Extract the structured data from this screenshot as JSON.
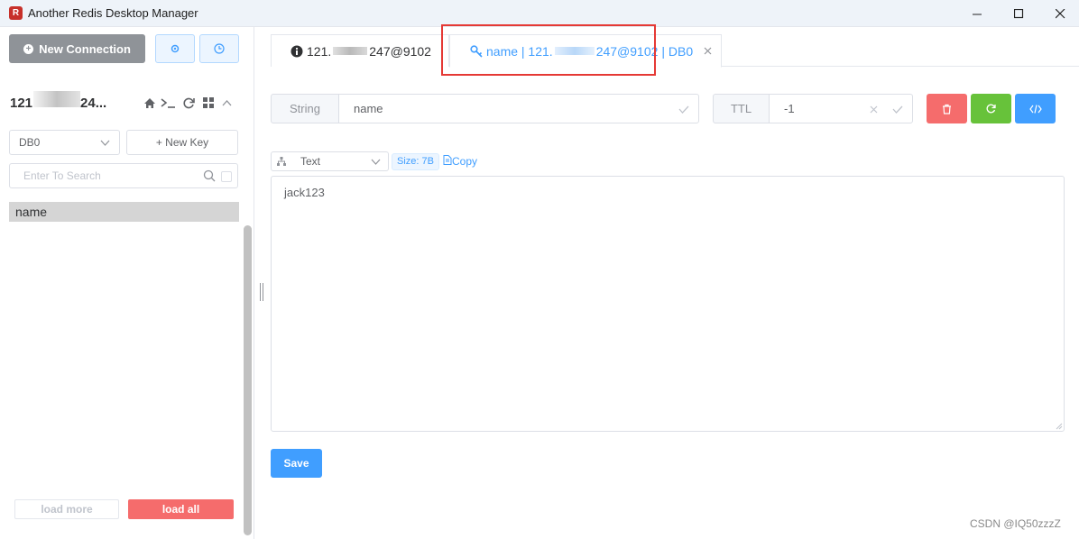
{
  "window": {
    "title": "Another Redis Desktop Manager"
  },
  "sidebar": {
    "new_connection_label": "New Connection",
    "connection": {
      "name_prefix": "121",
      "name_suffix": "24..."
    },
    "db_select": "DB0",
    "new_key_label": "+ New Key",
    "search_placeholder": "Enter To Search",
    "keys": [
      "name"
    ],
    "load_more_label": "load more",
    "load_all_label": "load all"
  },
  "tabs": [
    {
      "prefix": "121.",
      "suffix": "247@9102"
    },
    {
      "prefix": "name | 121.",
      "suffix": "247@9102",
      "db": "| DB0"
    }
  ],
  "key_detail": {
    "type_label": "String",
    "key_name": "name",
    "ttl_label": "TTL",
    "ttl_value": "-1",
    "format": "Text",
    "size_label": "Size: 7B",
    "copy_label": "Copy",
    "value": "jack123",
    "save_label": "Save"
  },
  "watermark": "CSDN @IQ50zzzZ",
  "colors": {
    "primary": "#409eff",
    "danger": "#f56c6c",
    "success": "#67c23a",
    "highlight": "#e53935"
  }
}
